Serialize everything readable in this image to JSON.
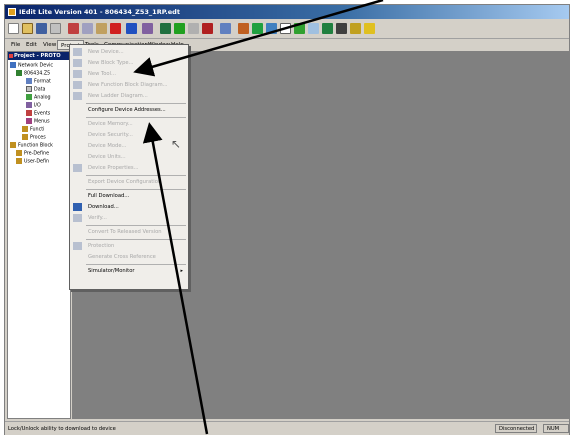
{
  "window": {
    "title": "IEdit Lite Version 401 - 806434_Z53_1RP.edt"
  },
  "menubar": {
    "items": [
      {
        "label": "File"
      },
      {
        "label": "Edit"
      },
      {
        "label": "View"
      },
      {
        "label": "Project"
      },
      {
        "label": "Tools"
      },
      {
        "label": "Communications"
      },
      {
        "label": "Window"
      },
      {
        "label": "Help"
      }
    ]
  },
  "tree": {
    "header": "Project - PROTO",
    "rows": [
      {
        "label": "Network Devic"
      },
      {
        "label": "806434.Z5"
      },
      {
        "label": "Format"
      },
      {
        "label": "Data"
      },
      {
        "label": "Analog"
      },
      {
        "label": "I/O"
      },
      {
        "label": "Events"
      },
      {
        "label": "Menus"
      },
      {
        "label": "Functi"
      },
      {
        "label": "Proces"
      },
      {
        "label": "Function Block"
      },
      {
        "label": "Pre-Define"
      },
      {
        "label": "User-Defin"
      }
    ]
  },
  "project_menu": {
    "items": [
      {
        "label": "New Device...",
        "enabled": false
      },
      {
        "label": "New Block Type...",
        "enabled": false
      },
      {
        "label": "New Tool...",
        "enabled": false
      },
      {
        "label": "New Function Block Diagram...",
        "enabled": false
      },
      {
        "label": "New Ladder Diagram...",
        "enabled": false
      },
      {
        "label": "Configure Device Addresses...",
        "enabled": true
      },
      {
        "label": "Device Memory...",
        "enabled": false
      },
      {
        "label": "Device Security...",
        "enabled": false
      },
      {
        "label": "Device Mode...",
        "enabled": false
      },
      {
        "label": "Device Units...",
        "enabled": false
      },
      {
        "label": "Device Properties...",
        "enabled": false
      },
      {
        "label": "Export Device Configuration",
        "enabled": false
      },
      {
        "label": "Full Download...",
        "enabled": true
      },
      {
        "label": "Download...",
        "enabled": true
      },
      {
        "label": "Verify...",
        "enabled": false
      },
      {
        "label": "Convert To Released Version",
        "enabled": false
      },
      {
        "label": "Protection",
        "enabled": false
      },
      {
        "label": "Generate Cross Reference",
        "enabled": false
      },
      {
        "label": "Simulator/Monitor",
        "enabled": true,
        "submenu": true
      }
    ]
  },
  "statusbar": {
    "message": "Lock/Unlock ability to download to device",
    "connection": "Disconnected",
    "num": "NUM"
  }
}
